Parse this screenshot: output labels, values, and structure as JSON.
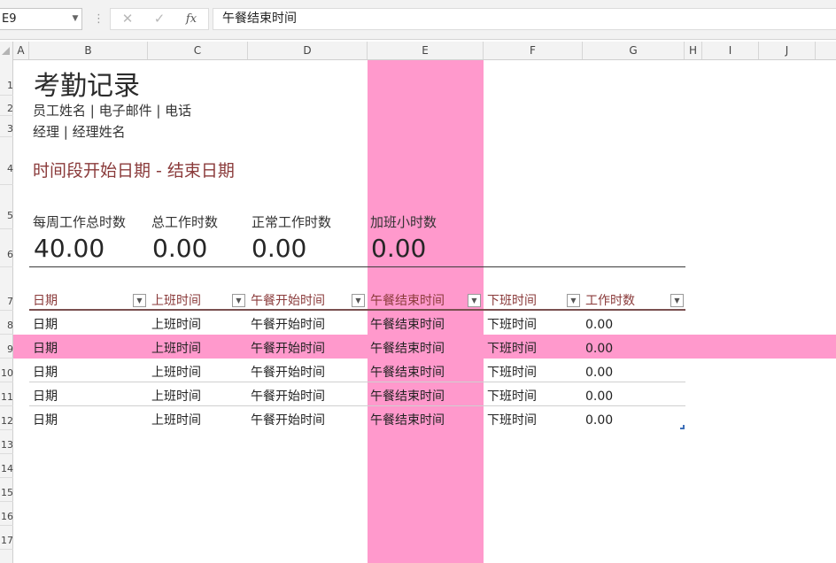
{
  "formula_bar": {
    "name_box": "E9",
    "formula": "午餐结束时间",
    "cancel_glyph": "✕",
    "enter_glyph": "✓",
    "fx_label": "fx"
  },
  "columns": [
    "A",
    "B",
    "C",
    "D",
    "E",
    "F",
    "G",
    "H",
    "I",
    "J"
  ],
  "rows": [
    "1",
    "2",
    "3",
    "4",
    "5",
    "6",
    "7",
    "8",
    "9",
    "10",
    "11",
    "12",
    "13",
    "14",
    "15",
    "16",
    "17"
  ],
  "sheet": {
    "title": "考勤记录",
    "employee_line": "员工姓名 | 电子邮件 | 电话",
    "manager_line": "经理 | 经理姓名",
    "period": "时间段开始日期 - 结束日期",
    "metrics": [
      {
        "label": "每周工作总时数",
        "value": "40.00"
      },
      {
        "label": "总工作时数",
        "value": "0.00"
      },
      {
        "label": "正常工作时数",
        "value": "0.00"
      },
      {
        "label": "加班小时数",
        "value": "0.00"
      }
    ],
    "table": {
      "headers": [
        "日期",
        "上班时间",
        "午餐开始时间",
        "午餐结束时间",
        "下班时间",
        "工作时数"
      ],
      "rows": [
        [
          "日期",
          "上班时间",
          "午餐开始时间",
          "午餐结束时间",
          "下班时间",
          "0.00"
        ],
        [
          "日期",
          "上班时间",
          "午餐开始时间",
          "午餐结束时间",
          "下班时间",
          "0.00"
        ],
        [
          "日期",
          "上班时间",
          "午餐开始时间",
          "午餐结束时间",
          "下班时间",
          "0.00"
        ],
        [
          "日期",
          "上班时间",
          "午餐开始时间",
          "午餐结束时间",
          "下班时间",
          "0.00"
        ],
        [
          "日期",
          "上班时间",
          "午餐开始时间",
          "午餐结束时间",
          "下班时间",
          "0.00"
        ]
      ]
    }
  },
  "colors": {
    "highlight": "#ff99cc",
    "accent_text": "#8a3a3a"
  }
}
